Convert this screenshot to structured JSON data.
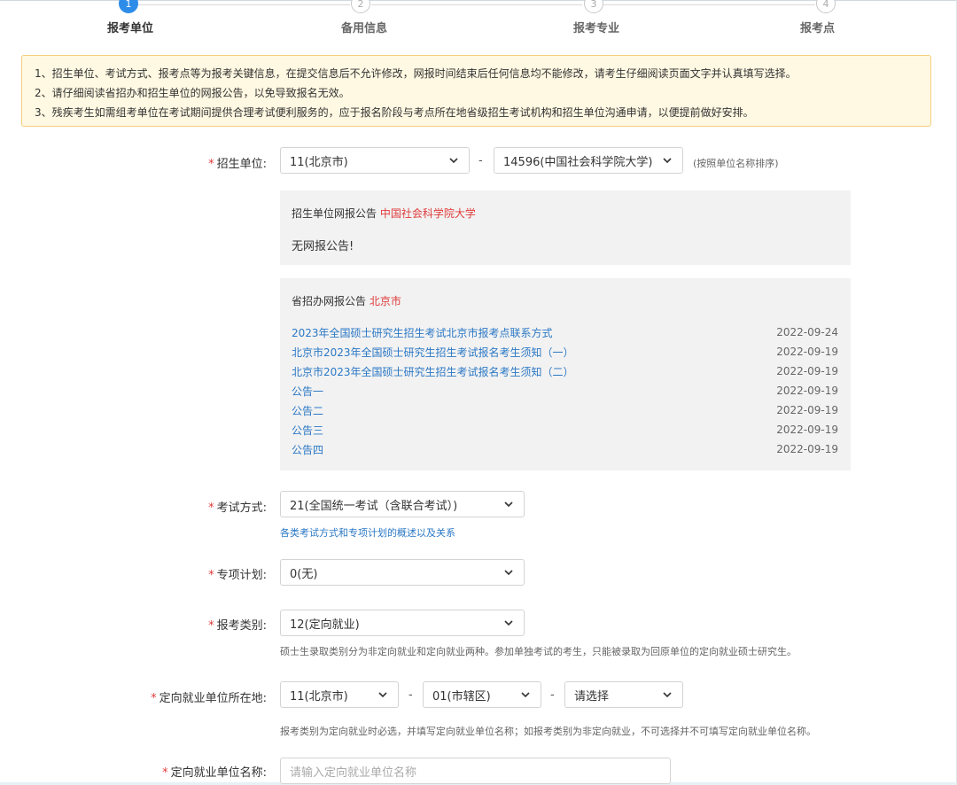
{
  "steps": [
    {
      "num": "1",
      "label": "报考单位"
    },
    {
      "num": "2",
      "label": "备用信息"
    },
    {
      "num": "3",
      "label": "报考专业"
    },
    {
      "num": "4",
      "label": "报考点"
    }
  ],
  "notice": [
    "1、招生单位、考试方式、报考点等为报考关键信息，在提交信息后不允许修改，网报时间结束后任何信息均不能修改，请考生仔细阅读页面文字并认真填写选择。",
    "2、请仔细阅读省招办和招生单位的网报公告，以免导致报名无效。",
    "3、残疾考生如需组考单位在考试期间提供合理考试便利服务的，应于报名阶段与考点所在地省级招生考试机构和招生单位沟通申请，以便提前做好安排。"
  ],
  "form": {
    "unit": {
      "required": "*",
      "label": "招生单位:",
      "province": "11(北京市)",
      "school": "14596(中国社会科学院大学)",
      "sort_hint": "(按照单位名称排序)"
    },
    "unit_notice": {
      "title": "招生单位网报公告",
      "title_highlight": "中国社会科学院大学",
      "text": "无网报公告!"
    },
    "province_notice": {
      "title": "省招办网报公告",
      "title_highlight": "北京市",
      "items": [
        {
          "title": "2023年全国硕士研究生招生考试北京市报考点联系方式",
          "date": "2022-09-24"
        },
        {
          "title": "北京市2023年全国硕士研究生招生考试报名考生须知（一）",
          "date": "2022-09-19"
        },
        {
          "title": "北京市2023年全国硕士研究生招生考试报名考生须知（二）",
          "date": "2022-09-19"
        },
        {
          "title": "公告一",
          "date": "2022-09-19"
        },
        {
          "title": "公告二",
          "date": "2022-09-19"
        },
        {
          "title": "公告三",
          "date": "2022-09-19"
        },
        {
          "title": "公告四",
          "date": "2022-09-19"
        }
      ]
    },
    "exam_mode": {
      "required": "*",
      "label": "考试方式:",
      "value": "21(全国统一考试（含联合考试）)",
      "link": "各类考试方式和专项计划的概述以及关系"
    },
    "special_plan": {
      "required": "*",
      "label": "专项计划:",
      "value": "0(无)"
    },
    "category": {
      "required": "*",
      "label": "报考类别:",
      "value": "12(定向就业)",
      "hint": "硕士生录取类别分为非定向就业和定向就业两种。参加单独考试的考生，只能被录取为回原单位的定向就业硕士研究生。"
    },
    "employer_location": {
      "required": "*",
      "label": "定向就业单位所在地:",
      "province": "11(北京市)",
      "district": "01(市辖区)",
      "third": "请选择",
      "hint": "报考类别为定向就业时必选，并填写定向就业单位名称；如报考类别为非定向就业，不可选择并不可填写定向就业单位名称。"
    },
    "employer_name": {
      "required": "*",
      "label": "定向就业单位名称:",
      "placeholder": "请输入定向就业单位名称"
    }
  },
  "icons": {
    "select_arrow": "chevron-down-icon"
  },
  "colors": {
    "primary": "#2d8ce8",
    "required": "#e03a3a",
    "link": "#2b78c5",
    "notice_bg": "#fff8e2",
    "notice_border": "#f3ce7c"
  }
}
